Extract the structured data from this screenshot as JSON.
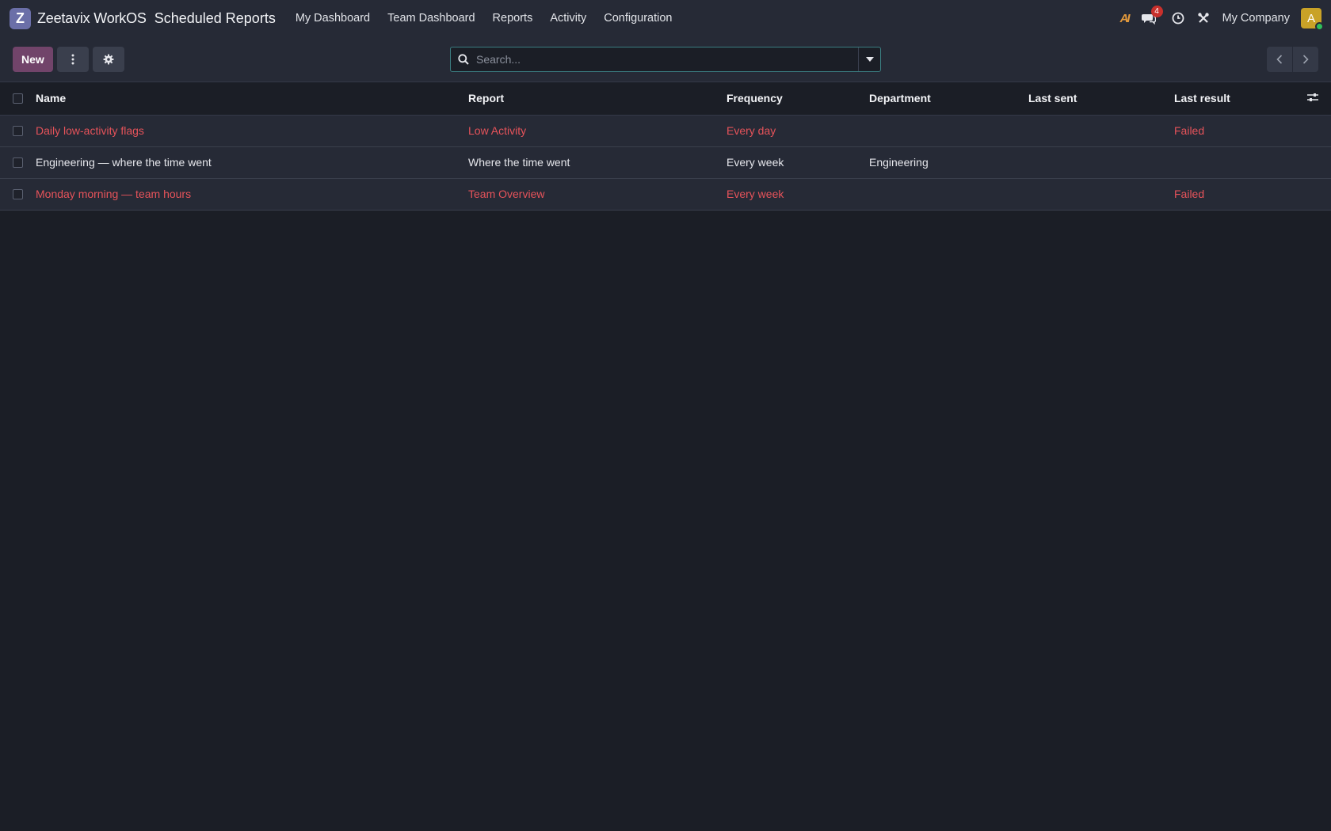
{
  "navbar": {
    "brand": "Zeetavix WorkOS",
    "logo_letter": "Z",
    "app_name": "Scheduled Reports",
    "menu": [
      {
        "label": "My Dashboard"
      },
      {
        "label": "Team Dashboard"
      },
      {
        "label": "Reports"
      },
      {
        "label": "Activity"
      },
      {
        "label": "Configuration"
      }
    ],
    "ai_label": "AI",
    "messages_count": "4",
    "company": "My Company",
    "avatar_letter": "A",
    "icons": [
      "ai-icon",
      "chat-icon",
      "clock-icon",
      "tools-icon"
    ]
  },
  "toolbar": {
    "new_label": "New",
    "search_placeholder": "Search..."
  },
  "table": {
    "columns": [
      "Name",
      "Report",
      "Frequency",
      "Department",
      "Last sent",
      "Last result"
    ],
    "rows": [
      {
        "name": "Daily low-activity flags",
        "report": "Low Activity",
        "frequency": "Every day",
        "department": "",
        "last_sent": "",
        "last_result": "Failed",
        "status": "danger"
      },
      {
        "name": "Engineering — where the time went",
        "report": "Where the time went",
        "frequency": "Every week",
        "department": "Engineering",
        "last_sent": "",
        "last_result": "",
        "status": "normal"
      },
      {
        "name": "Monday morning — team hours",
        "report": "Team Overview",
        "frequency": "Every week",
        "department": "",
        "last_sent": "",
        "last_result": "Failed",
        "status": "danger"
      }
    ]
  },
  "colors": {
    "primary": "#71446a",
    "danger": "#e6535a",
    "background": "#1b1e26",
    "panel": "#262a36"
  }
}
